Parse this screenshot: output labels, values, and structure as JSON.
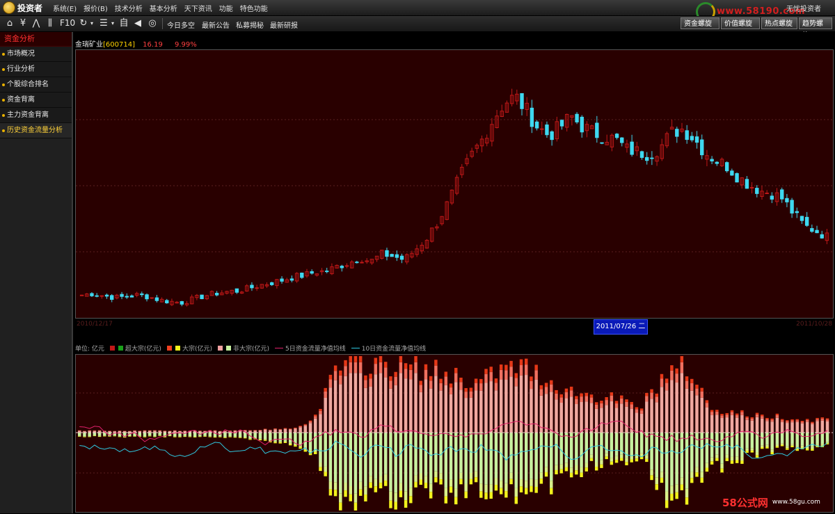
{
  "app": {
    "logo_text": "投资者",
    "user": "无忧投资者",
    "watermark_top": "www.58190.com",
    "watermark_bottom": "58公式网",
    "watermark_bottom_url": "www.58gu.com"
  },
  "menu": [
    "系统(E)",
    "报价(B)",
    "技术分析",
    "基本分析",
    "天下资讯",
    "功能",
    "特色功能"
  ],
  "toolbar": {
    "f10": "F10",
    "zi": "自",
    "links": [
      "今日多空",
      "最新公告",
      "私募揭秘",
      "最新研报"
    ]
  },
  "tabs": [
    "资金螺旋",
    "价值螺旋",
    "热点螺旋",
    "趋势螺旋"
  ],
  "sidebar": {
    "title": "资金分析",
    "items": [
      {
        "label": "市场概况"
      },
      {
        "label": "行业分析"
      },
      {
        "label": "个股综合排名"
      },
      {
        "label": "资金背离"
      },
      {
        "label": "主力资金背离"
      },
      {
        "label": "历史资金流量分析"
      }
    ]
  },
  "stock": {
    "name": "金瑞矿业",
    "code": "[600714]",
    "price": "16.19",
    "change": "9.99%"
  },
  "dates": {
    "start": "2010/12/17",
    "end": "2011/10/28",
    "cursor": "2011/07/26 二"
  },
  "legend": {
    "unit": "单位: 亿元",
    "super": "超大宗(亿元)",
    "large": "大宗(亿元)",
    "nonlarge": "非大宗(亿元)",
    "ma5": "5日资金流量净值均线",
    "ma10": "10日资金流量净值均线"
  },
  "colors": {
    "up": "#c01818",
    "down": "#3ed8f0",
    "bg": "#290000",
    "super_in": "#e53818",
    "large_in": "#f07060",
    "small_in": "#f0a8a0",
    "super_out": "#f2f21c",
    "large_out": "#d8f08a",
    "small_out": "#c8f0a0",
    "ma5": "#e0206a",
    "ma10": "#2ec8e0"
  },
  "chart_data": [
    {
      "type": "candlestick",
      "title": "",
      "xlabel": "",
      "ylabel": "",
      "x_range": [
        "2010/12/17",
        "2011/10/28"
      ],
      "close_trend": [
        12.1,
        12.3,
        12.0,
        11.8,
        11.9,
        12.1,
        11.9,
        11.5,
        11.3,
        11.2,
        11.6,
        12.0,
        12.3,
        12.5,
        12.6,
        12.9,
        13.3,
        13.6,
        13.9,
        14.3,
        14.5,
        14.9,
        15.0,
        15.6,
        16.0,
        16.6,
        16.2,
        17.1,
        16.8,
        16.4,
        17.6,
        19.0,
        21.0,
        23.5,
        26.5,
        29.0,
        31.0,
        33.5,
        35.5,
        36.2,
        34.5,
        32.5,
        31.5,
        32.5,
        33.8,
        32.6,
        31.8,
        31.4,
        31.0,
        29.8,
        29.5,
        29.2,
        30.0,
        31.8,
        32.3,
        31.2,
        29.5,
        28.5,
        27.8,
        26.5,
        25.5,
        24.8,
        24.5,
        23.8,
        22.0,
        20.5,
        19.9,
        19.2
      ],
      "ylim": [
        10,
        40
      ]
    },
    {
      "type": "bar",
      "title": "",
      "xlabel": "",
      "ylabel": "单位: 亿元",
      "series": [
        {
          "name": "超大宗(亿元)"
        },
        {
          "name": "大宗(亿元)"
        },
        {
          "name": "非大宗(亿元)"
        },
        {
          "name": "5日资金流量净值均线"
        },
        {
          "name": "10日资金流量净值均线"
        }
      ],
      "inflow_trend": [
        0.05,
        0.05,
        0.05,
        0.05,
        0.05,
        0.05,
        0.05,
        0.06,
        0.08,
        0.1,
        0.3,
        1.5,
        1.7,
        1.7,
        1.6,
        1.5,
        1.4,
        1.2,
        1.5,
        1.6,
        1.3,
        1.0,
        0.9,
        0.8,
        0.6,
        1.4,
        1.6,
        0.6,
        0.5,
        0.4,
        0.4,
        0.3,
        0.35
      ],
      "outflow_trend": [
        0.1,
        0.1,
        0.1,
        0.1,
        0.1,
        0.1,
        0.1,
        0.15,
        0.2,
        0.3,
        0.5,
        1.6,
        1.7,
        1.6,
        1.5,
        1.4,
        1.5,
        1.3,
        1.4,
        1.5,
        1.3,
        1.0,
        0.8,
        0.7,
        0.6,
        1.5,
        1.6,
        0.9,
        0.7,
        0.5,
        0.4,
        0.4,
        0.35
      ]
    }
  ]
}
